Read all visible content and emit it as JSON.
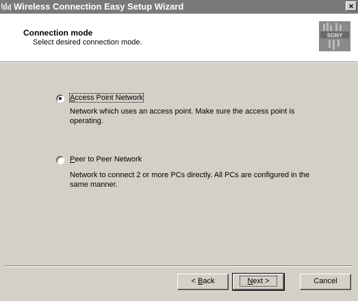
{
  "window": {
    "title": "Wireless Connection Easy Setup Wizard",
    "close_label": "×"
  },
  "header": {
    "title": "Connection mode",
    "subtitle": "Select desired connection mode.",
    "logo_text": "SONY"
  },
  "options": [
    {
      "label_prefix": "",
      "label_accel": "A",
      "label_rest": "ccess Point Network",
      "description": "Network which uses an access point. Make sure the access point is operating.",
      "selected": true
    },
    {
      "label_prefix": "",
      "label_accel": "P",
      "label_rest": "eer to Peer Network",
      "description": "Network to connect 2 or more PCs directly. All PCs are configured in the same manner.",
      "selected": false
    }
  ],
  "buttons": {
    "back_prefix": "< ",
    "back_accel": "B",
    "back_rest": "ack",
    "next_accel": "N",
    "next_rest": "ext >",
    "cancel": "Cancel"
  }
}
